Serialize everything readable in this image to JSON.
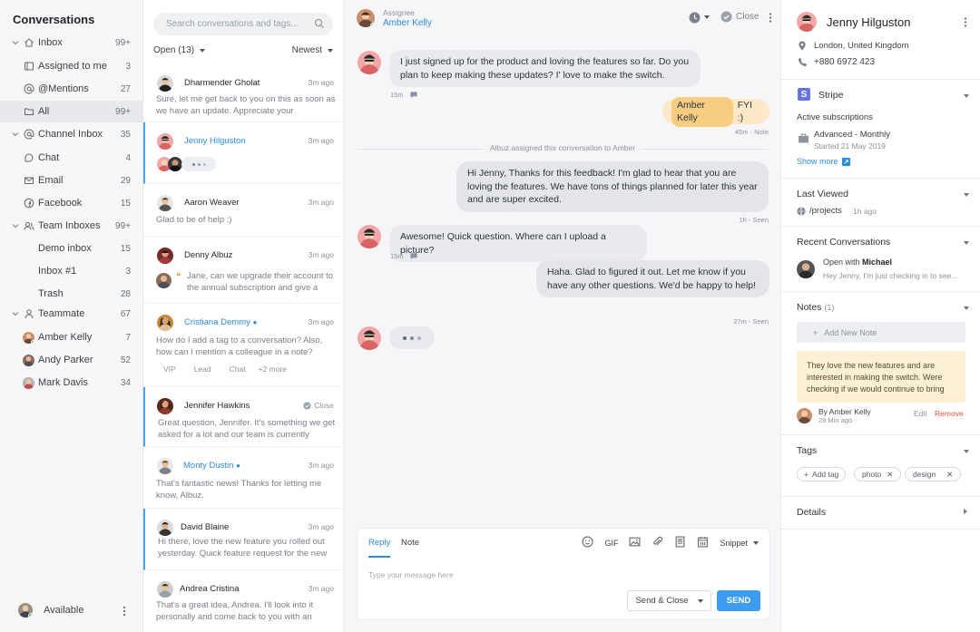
{
  "nav": {
    "title": "Conversations",
    "items": [
      {
        "label": "Inbox",
        "count": "99+"
      },
      {
        "label": "Assigned to me",
        "count": "3"
      },
      {
        "label": "@Mentions",
        "count": "27"
      },
      {
        "label": "All",
        "count": "99+"
      },
      {
        "label": "Channel Inbox",
        "count": "35"
      },
      {
        "label": "Chat",
        "count": "4"
      },
      {
        "label": "Email",
        "count": "29"
      },
      {
        "label": "Facebook",
        "count": "15"
      },
      {
        "label": "Team Inboxes",
        "count": "99+"
      },
      {
        "label": "Demo inbox",
        "count": "15"
      },
      {
        "label": "Inbox #1",
        "count": "3"
      },
      {
        "label": "Trash",
        "count": "28"
      },
      {
        "label": "Teammate",
        "count": "67"
      },
      {
        "label": "Amber Kelly",
        "count": "7"
      },
      {
        "label": "Andy Parker",
        "count": "52"
      },
      {
        "label": "Mark Davis",
        "count": "34"
      }
    ],
    "status_label": "Available"
  },
  "list": {
    "search_placeholder": "Search conversations and tags...",
    "filter_open": "Open (13)",
    "filter_sort": "Newest",
    "conversations": [
      {
        "name": "Dharmender Gholat",
        "time": "3m ago",
        "preview": "Sure, let me get back to you on this as soon as we have an update. Appreciate your"
      },
      {
        "name": "Jenny Hilguston",
        "time": "3m ago",
        "preview": ""
      },
      {
        "name": "Aaron Weaver",
        "time": "3m ago",
        "preview": "Glad to be of help :)"
      },
      {
        "name": "Denny Albuz",
        "time": "3m ago",
        "preview": "Jane, can we upgrade their account to the annual subscription and give a"
      },
      {
        "name": "Cristiana Demmy",
        "time": "3m ago",
        "preview": "How do I add a tag to a conversation? Also, how can I mention a colleague in a note?",
        "tags": [
          "VIP",
          "Lead",
          "Chat",
          "+2 more"
        ]
      },
      {
        "name": "Jennifer Hawkins",
        "time": "Close",
        "preview": "Great question, Jennifer. It's something we get asked for a lot and our team is currently"
      },
      {
        "name": "Monty Dustin",
        "time": "3m ago",
        "preview": "That's fantastic news! Thanks for letting me know, Albuz."
      },
      {
        "name": "David Blaine",
        "time": "3m ago",
        "preview": "Hi there, love the new feature you rolled out yesterday. Quick feature request for the new"
      },
      {
        "name": "Andrea Cristina",
        "time": "3m ago",
        "preview": "That's a great idea, Andrea. I'll look into it personally and come back to you with an"
      }
    ]
  },
  "chat": {
    "assignee_label": "Assignee",
    "assignee_name": "Amber Kelly",
    "close_label": "Close",
    "messages": [
      {
        "text": "I just signed up for the product and loving the features so far. Do you plan to keep making these updates? I' love to make the switch.",
        "meta": "15m"
      },
      {
        "mention": "Amber Kelly",
        "text": "FYI :)",
        "meta": "45m - Note"
      },
      {
        "text": "Hi Jenny, Thanks for this feedback! I'm glad to hear that you are loving the features. We have tons of things planned for later this year and are super excited.",
        "meta": "1h - Seen"
      },
      {
        "text": "Awesome! Quick question. Where can I upload a picture?",
        "meta": "15m"
      },
      {
        "text": "Haha. Glad to figured it out. Let me know if you have any other questions. We'd be happy to help!",
        "meta": "27m - Seen"
      }
    ],
    "system_note": "Albuz assigned this conversation to Amber",
    "composer": {
      "tab_reply": "Reply",
      "tab_note": "Note",
      "gif": "GIF",
      "snippet": "Snippet",
      "placeholder": "Type your message here",
      "send_close": "Send & Close",
      "send": "SEND"
    }
  },
  "side": {
    "name": "Jenny Hilguston",
    "location": "London, United Kingdom",
    "phone": "+880 6972 423",
    "stripe": {
      "title": "Stripe",
      "subs_label": "Active subscriptions",
      "plan": "Advanced -  Monthly",
      "started": "Started 21 May 2019",
      "show_more": "Show more"
    },
    "last_viewed": {
      "title": "Last Viewed",
      "path": "/projects",
      "time": "1h ago"
    },
    "recent": {
      "title": "Recent Conversations",
      "open_with": "Open with",
      "with_name": "Michael",
      "preview": "Hey Jenny, I'm just checking in to see..."
    },
    "notes": {
      "title": "Notes",
      "count": "(1)",
      "add": "Add New Note",
      "note": "They love the new features and are interested in making the switch. Were checking if we would continue to bring",
      "by": "By Amber Kelly",
      "ago": "28 Min ago",
      "edit": "Edit",
      "remove": "Remove"
    },
    "tags": {
      "title": "Tags",
      "add": "Add tag",
      "items": [
        "photo",
        "design"
      ]
    },
    "details": {
      "title": "Details"
    }
  },
  "colors": {
    "accent": "#2a8de0",
    "send": "#3b9cf0",
    "note_bg": "#fdf0d5",
    "online": "#2ec46b",
    "danger": "#e5533d"
  }
}
